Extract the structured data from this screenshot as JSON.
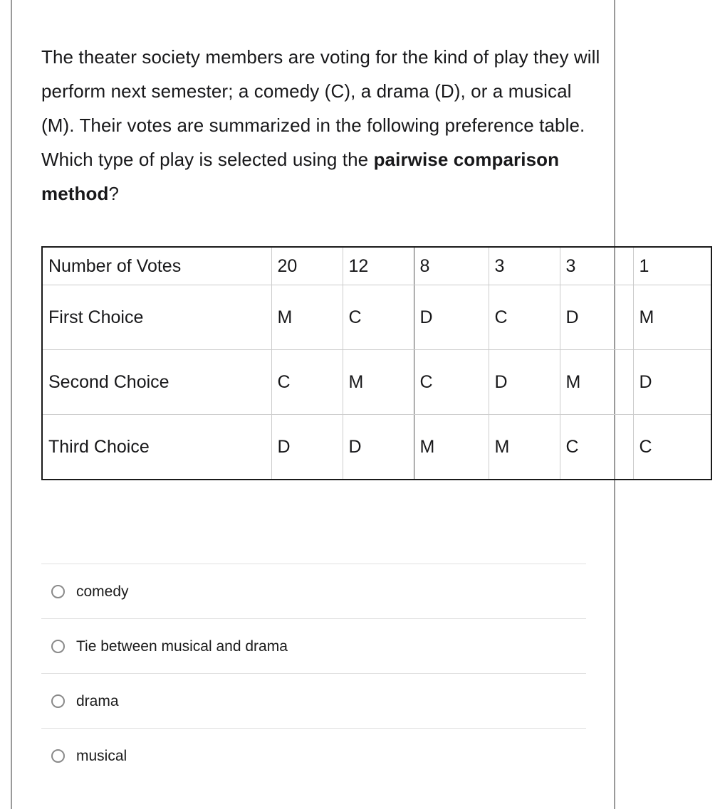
{
  "prompt": {
    "part1": "The theater society members are voting for the kind of play they will perform next semester; a comedy (C), a drama (D), or a musical (M). Their votes are summarized in the following preference table. Which type of play is selected using the ",
    "bold": "pairwise comparison method",
    "part2": "?"
  },
  "table": {
    "rows": [
      {
        "label": "Number of Votes",
        "cells": [
          "20",
          "12",
          "8",
          "3",
          "3",
          "1"
        ]
      },
      {
        "label": "First Choice",
        "cells": [
          "M",
          "C",
          "D",
          "C",
          "D",
          "M"
        ]
      },
      {
        "label": "Second Choice",
        "cells": [
          "C",
          "M",
          "C",
          "D",
          "M",
          "D"
        ]
      },
      {
        "label": "Third Choice",
        "cells": [
          "D",
          "D",
          "M",
          "M",
          "C",
          "C"
        ]
      }
    ]
  },
  "options": [
    {
      "label": "comedy",
      "selected": false
    },
    {
      "label": "Tie between musical and drama",
      "selected": false
    },
    {
      "label": "drama",
      "selected": false
    },
    {
      "label": "musical",
      "selected": false
    }
  ],
  "colors": {
    "text": "#18181a",
    "table_outer_border": "#1a1a1a",
    "table_inner_border": "#cccccc",
    "table_dark_divider": "#555555",
    "page_rule": "#9a9a9a",
    "option_separator": "#e0e0e0",
    "radio_stroke": "#8a8a8a"
  }
}
